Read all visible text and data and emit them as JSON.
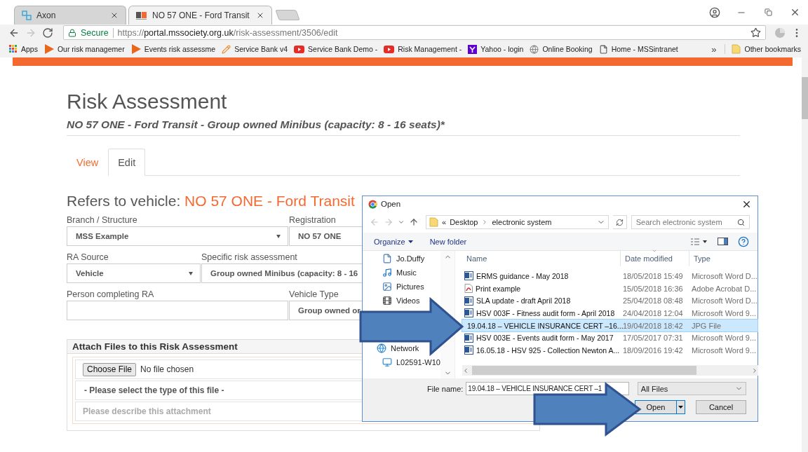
{
  "browser": {
    "tabs": [
      {
        "title": "Axon",
        "selected": false
      },
      {
        "title": "NO 57 ONE - Ford Transit",
        "selected": true
      }
    ],
    "nav_buttons": [
      {
        "kind": "back",
        "disabled": false
      },
      {
        "kind": "forward",
        "disabled": true
      },
      {
        "kind": "reload",
        "disabled": false
      }
    ],
    "address": {
      "secure_label": "Secure",
      "scheme": "https://",
      "host": "portal.mssociety.org.uk",
      "path": "/risk-assessment/3506/edit"
    },
    "bookmarks": [
      {
        "label": "Apps",
        "kind": "apps"
      },
      {
        "label": "Our risk managemer",
        "kind": "play"
      },
      {
        "label": "Events risk assessme",
        "kind": "play"
      },
      {
        "label": "Service Bank v4",
        "kind": "pencil"
      },
      {
        "label": "Service Bank Demo -",
        "kind": "video"
      },
      {
        "label": "Risk Management -",
        "kind": "video"
      },
      {
        "label": "Yahoo - login",
        "kind": "yahoo"
      },
      {
        "label": "Online Booking",
        "kind": "globe"
      },
      {
        "label": "Home - MSSintranet",
        "kind": "page"
      }
    ],
    "bookmarks_overflow": "»",
    "other_bookmarks": "Other bookmarks"
  },
  "page": {
    "title": "Risk Assessment",
    "subtitle": "NO 57 ONE - Ford Transit - Group owned Minibus (capacity: 8 - 16 seats)*",
    "tabs": [
      {
        "label": "View",
        "selected": false
      },
      {
        "label": "Edit",
        "selected": true
      }
    ],
    "heading": "Refers to vehicle:",
    "heading_vehicle": "NO 57 ONE - Ford Transit",
    "form_rows": [
      [
        {
          "label": "Branch / Structure",
          "value": "MSS Example",
          "kind": "select"
        },
        {
          "label": "Registration",
          "value": "NO 57 ONE",
          "kind": "text"
        }
      ],
      [
        {
          "label": "RA Source",
          "value": "Vehicle",
          "kind": "select"
        },
        {
          "label": "Specific risk assessment",
          "value": "Group owned Minibus (capacity: 8 - 16",
          "kind": "text"
        }
      ],
      [
        {
          "label": "Person completing RA",
          "kind": "text"
        },
        {
          "label": "Vehicle Type",
          "value": "Group owned or",
          "kind": "text"
        }
      ]
    ],
    "attach": {
      "title": "Attach Files to this Risk Assessment",
      "choose_button": "Choose File",
      "file_status": "No file chosen",
      "type_select": "- Please select the type of this file -",
      "description_placeholder": "Please describe this attachment"
    }
  },
  "dialog": {
    "title": "Open",
    "nav_buttons": [
      {
        "kind": "back",
        "disabled": true
      },
      {
        "kind": "forward",
        "disabled": true
      },
      {
        "kind": "recent",
        "disabled": false
      },
      {
        "kind": "up",
        "disabled": false
      }
    ],
    "breadcrumb": {
      "overflow": "«",
      "parts": [
        "Desktop",
        "electronic system"
      ]
    },
    "search_placeholder": "Search electronic system",
    "toolbar": {
      "organize": "Organize",
      "new_folder": "New folder"
    },
    "nav_pane": [
      {
        "label": "Jo.Duffy",
        "kind": "user"
      },
      {
        "label": "Music",
        "kind": "music"
      },
      {
        "label": "Pictures",
        "kind": "pictures"
      },
      {
        "label": "Videos",
        "kind": "videos"
      },
      {
        "label": "Network",
        "kind": "network",
        "children": [
          {
            "label": "L02591-W10",
            "kind": "computer"
          }
        ]
      }
    ],
    "columns": [
      "Name",
      "Date modified",
      "Type"
    ],
    "files": [
      {
        "name": "ERMS guidance - May 2018",
        "date": "18/05/2018 15:49",
        "type": "Microsoft Word D...",
        "kind": "word",
        "selected": false
      },
      {
        "name": "Print example",
        "date": "15/05/2018 16:36",
        "type": "Adobe Acrobat D...",
        "kind": "pdf",
        "selected": false
      },
      {
        "name": "SLA update - draft April 2018",
        "date": "25/04/2018 08:48",
        "type": "Microsoft Word D...",
        "kind": "word",
        "selected": false
      },
      {
        "name": "HSV 003F - Fitness audit form - April 2018",
        "date": "24/04/2018 12:04",
        "type": "Microsoft Word 9...",
        "kind": "word",
        "selected": false
      },
      {
        "name": "19.04.18 – VEHICLE INSURANCE CERT –16...",
        "date": "19/04/2018 18:42",
        "type": "JPG File",
        "kind": "image",
        "selected": true
      },
      {
        "name": "HSV 003E - Events audit form - May 2017",
        "date": "17/05/2017 07:31",
        "type": "Microsoft Word 9...",
        "kind": "word",
        "selected": false
      },
      {
        "name": "16.05.18 - HSV 925 - Collection Newton A...",
        "date": "18/09/2016 19:42",
        "type": "Microsoft Word 9...",
        "kind": "word",
        "selected": false
      }
    ],
    "file_name_label": "File name:",
    "file_name": "19.04.18 – VEHICLE INSURANCE CERT –1",
    "filter": "All Files",
    "buttons": {
      "open": "Open",
      "cancel": "Cancel"
    }
  }
}
